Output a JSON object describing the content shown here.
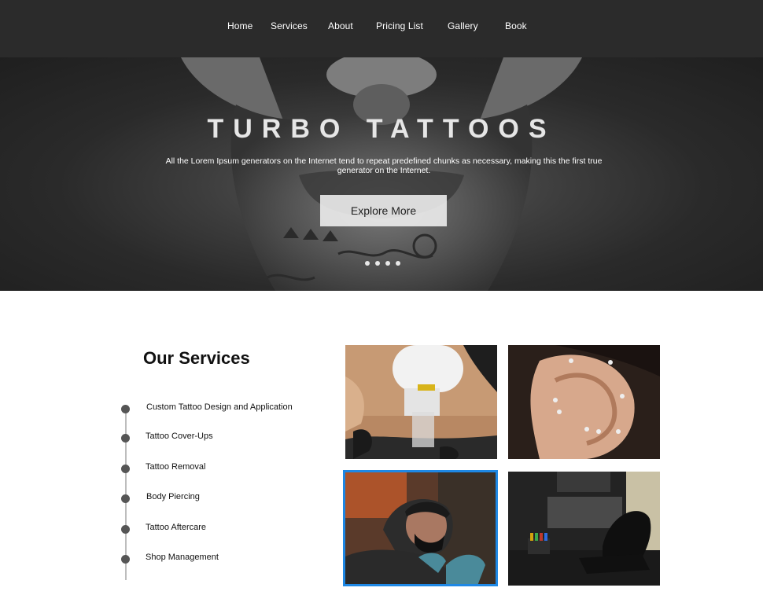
{
  "nav": {
    "items": [
      "Home",
      "Services",
      "About",
      "Pricing List",
      "Gallery",
      "Book"
    ]
  },
  "hero": {
    "title": "TURBO TATTOOS",
    "description": "All the Lorem Ipsum generators on the Internet tend to repeat predefined chunks as necessary, making this the first true generator on the Internet.",
    "cta_label": "Explore More",
    "slide_count": 4
  },
  "services": {
    "title": "Our Services",
    "items": [
      "Custom Tattoo Design and Application",
      "Tattoo Cover-Ups",
      "Tattoo Removal",
      "Body Piercing",
      "Tattoo Aftercare",
      "Shop Management"
    ]
  },
  "gallery": {
    "selected_index": 2,
    "accent_color": "#1e88e5"
  }
}
